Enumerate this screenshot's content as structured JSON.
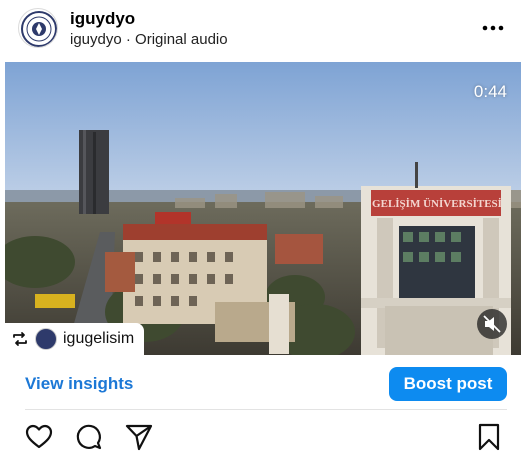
{
  "post": {
    "username": "iguydyo",
    "subtitle": "iguydyo · Original audio",
    "avatar_icon": "university-seal-icon",
    "more_icon": "ellipsis-icon"
  },
  "media": {
    "duration": "0:44",
    "sign_text": "GELİŞİM ÜNİVERSİTESİ",
    "mute_icon": "speaker-muted-icon",
    "repost": {
      "icon": "repost-icon",
      "username": "igugelisim"
    }
  },
  "actions": {
    "view_insights": "View insights",
    "boost_post": "Boost post",
    "boost_color": "#0d8bf0",
    "insights_color": "#1c78d6"
  },
  "toolbar": {
    "like_icon": "heart-icon",
    "comment_icon": "comment-icon",
    "share_icon": "send-icon",
    "save_icon": "bookmark-icon"
  }
}
